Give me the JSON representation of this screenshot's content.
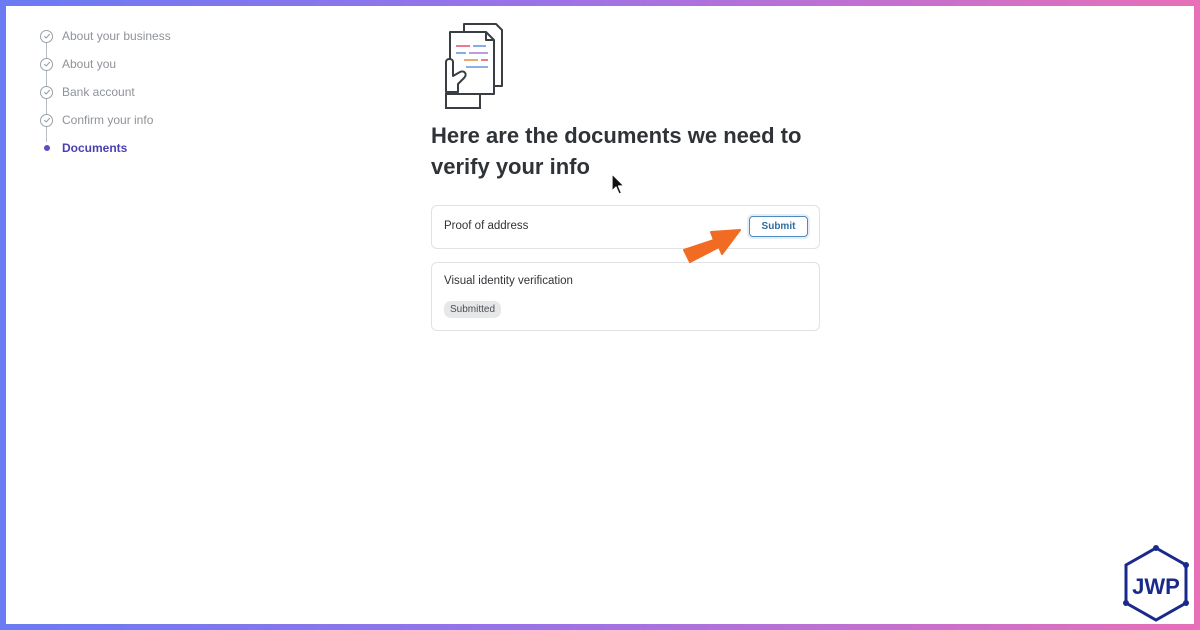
{
  "stepper": {
    "steps": [
      {
        "label": "About your business",
        "status": "complete"
      },
      {
        "label": "About you",
        "status": "complete"
      },
      {
        "label": "Bank account",
        "status": "complete"
      },
      {
        "label": "Confirm your info",
        "status": "complete"
      },
      {
        "label": "Documents",
        "status": "current"
      }
    ]
  },
  "main": {
    "icon": "document-hand-icon",
    "heading": "Here are the documents we need to verify your info",
    "documents": [
      {
        "title": "Proof of address",
        "action_label": "Submit"
      },
      {
        "title": "Visual identity verification",
        "status_label": "Submitted"
      }
    ]
  },
  "overlay": {
    "annotation_icon": "orange-arrow-icon",
    "cursor_icon": "mouse-cursor-icon",
    "watermark_text": "JWP"
  },
  "colors": {
    "accent": "#4b3fb5",
    "button_border": "#4d8bbf",
    "annotation": "#f26b22",
    "frame_gradient_start": "#6a7bf3",
    "frame_gradient_end": "#e86fb8"
  }
}
